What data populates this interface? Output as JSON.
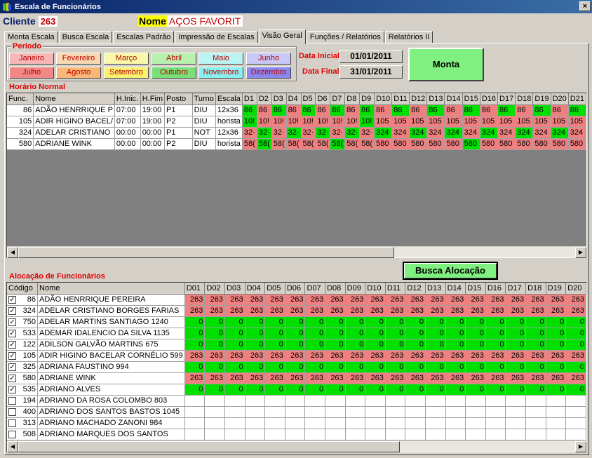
{
  "window": {
    "title": "Escala de Funcionários",
    "close_label": "×"
  },
  "header": {
    "cliente_label": "Cliente",
    "cliente_value": "263",
    "nome_label": "Nome",
    "nome_value": "AÇOS FAVORIT"
  },
  "tabs": [
    {
      "label": "Monta Escala",
      "active": false
    },
    {
      "label": "Busca Escala",
      "active": false
    },
    {
      "label": "Escalas Padrão",
      "active": false
    },
    {
      "label": "Impressão de Escalas",
      "active": false
    },
    {
      "label": "Visão Geral",
      "active": true
    },
    {
      "label": "Funções / Relatórios",
      "active": false
    },
    {
      "label": "Relatórios II",
      "active": false
    }
  ],
  "periodo": {
    "title": "Período",
    "months": [
      {
        "label": "Janeiro",
        "color": "#f4b8b8"
      },
      {
        "label": "Fevereiro",
        "color": "#f8d8b0"
      },
      {
        "label": "Março",
        "color": "#f8f8a8"
      },
      {
        "label": "Abril",
        "color": "#b8f0b0"
      },
      {
        "label": "Maio",
        "color": "#b8f4f4"
      },
      {
        "label": "Junho",
        "color": "#c8c8f8"
      },
      {
        "label": "Julho",
        "color": "#f08888"
      },
      {
        "label": "Agosto",
        "color": "#f8b878"
      },
      {
        "label": "Setembro",
        "color": "#f8f070"
      },
      {
        "label": "Outubro",
        "color": "#78e078"
      },
      {
        "label": "Novembro",
        "color": "#88f0f0"
      },
      {
        "label": "Dezembro",
        "color": "#8888f0"
      }
    ]
  },
  "datas": {
    "inicial_label": "Data Inicial",
    "inicial_value": "01/01/2011",
    "final_label": "Data Final",
    "final_value": "31/01/2011"
  },
  "monta_button": "Monta",
  "horario": {
    "title": "Horário Normal",
    "columns": [
      "Func.",
      "Nome",
      "H.Inic.",
      "H.Fim",
      "Posto",
      "Turno",
      "Escala",
      "D1",
      "D2",
      "D3",
      "D4",
      "D5",
      "D6",
      "D7",
      "D8",
      "D9",
      "D10",
      "D11",
      "D12",
      "D13",
      "D14",
      "D15",
      "D16",
      "D17",
      "D18",
      "D19",
      "D20",
      "D21"
    ],
    "rows": [
      {
        "func": "86",
        "nome": "ADÃO HENRRIQUE P",
        "hinic": "07:00",
        "hfim": "19:00",
        "posto": "P1",
        "turno": "DIU",
        "escala": "12x36",
        "days": [
          "86",
          "86",
          "86",
          "86",
          "86",
          "86",
          "86",
          "86",
          "86",
          "86",
          "86",
          "86",
          "86",
          "86",
          "86",
          "86",
          "86",
          "86",
          "86",
          "86",
          "86"
        ],
        "colors": [
          "g",
          "r",
          "g",
          "r",
          "g",
          "r",
          "g",
          "r",
          "g",
          "r",
          "g",
          "r",
          "g",
          "r",
          "g",
          "r",
          "g",
          "r",
          "g",
          "r",
          "g"
        ]
      },
      {
        "func": "105",
        "nome": "ADIR HIGINO BACEL/",
        "hinic": "07:00",
        "hfim": "19:00",
        "posto": "P2",
        "turno": "DIU",
        "escala": "horista",
        "days": [
          "10!",
          "10!",
          "10!",
          "10!",
          "10!",
          "10!",
          "10!",
          "10!",
          "10!",
          "105",
          "105",
          "105",
          "105",
          "105",
          "105",
          "105",
          "105",
          "105",
          "105",
          "105",
          "105"
        ],
        "colors": [
          "g",
          "r",
          "r",
          "r",
          "r",
          "r",
          "r",
          "r",
          "g",
          "r",
          "r",
          "r",
          "r",
          "r",
          "r",
          "r",
          "r",
          "r",
          "r",
          "r",
          "r"
        ]
      },
      {
        "func": "324",
        "nome": "ADELAR CRISTIANO",
        "hinic": "00:00",
        "hfim": "00:00",
        "posto": "P1",
        "turno": "NOT",
        "escala": "12x36",
        "days": [
          "32·",
          "32·",
          "32·",
          "32·",
          "32·",
          "32·",
          "32·",
          "32·",
          "32·",
          "324",
          "324",
          "324",
          "324",
          "324",
          "324",
          "324",
          "324",
          "324",
          "324",
          "324",
          "324"
        ],
        "colors": [
          "r",
          "g",
          "r",
          "g",
          "r",
          "g",
          "r",
          "g",
          "r",
          "g",
          "r",
          "g",
          "r",
          "g",
          "r",
          "g",
          "r",
          "g",
          "r",
          "g",
          "r"
        ]
      },
      {
        "func": "580",
        "nome": "ADRIANE WINK",
        "hinic": "00:00",
        "hfim": "00:00",
        "posto": "P2",
        "turno": "DIU",
        "escala": "horista",
        "days": [
          "58(",
          "58(",
          "58(",
          "58(",
          "58(",
          "58(",
          "58(",
          "58(",
          "58(",
          "580",
          "580",
          "580",
          "580",
          "580",
          "580",
          "580",
          "580",
          "580",
          "580",
          "580",
          "580"
        ],
        "colors": [
          "r",
          "g",
          "r",
          "r",
          "r",
          "r",
          "g",
          "r",
          "r",
          "r",
          "r",
          "r",
          "r",
          "r",
          "g",
          "r",
          "r",
          "r",
          "r",
          "r",
          "r"
        ]
      }
    ]
  },
  "busca_button": "Busca Alocação",
  "alocacao": {
    "title": "Alocação de Funcionários",
    "columns": [
      "Código",
      "Nome",
      "D01",
      "D02",
      "D03",
      "D04",
      "D05",
      "D06",
      "D07",
      "D08",
      "D09",
      "D10",
      "D11",
      "D12",
      "D13",
      "D14",
      "D15",
      "D16",
      "D17",
      "D18",
      "D19",
      "D20"
    ],
    "rows": [
      {
        "checked": true,
        "codigo": "86",
        "nome": "ADÃO HENRRIQUE PEREIRA",
        "value": "263",
        "color": "r"
      },
      {
        "checked": true,
        "codigo": "324",
        "nome": "ADELAR CRISTIANO BORGES FARIAS",
        "value": "263",
        "color": "r"
      },
      {
        "checked": true,
        "codigo": "750",
        "nome": "ADELAR MARTINS SANTIAGO 1240",
        "value": "0",
        "color": "g"
      },
      {
        "checked": true,
        "codigo": "533",
        "nome": "ADEMAR IDALENCIO DA SILVA 1135",
        "value": "0",
        "color": "g"
      },
      {
        "checked": true,
        "codigo": "122",
        "nome": "ADILSON GALVÃO MARTINS 675",
        "value": "0",
        "color": "g"
      },
      {
        "checked": true,
        "codigo": "105",
        "nome": "ADIR HIGINO BACELAR CORNÉLIO 599",
        "value": "263",
        "color": "r"
      },
      {
        "checked": true,
        "codigo": "325",
        "nome": "ADRIANA FAUSTINO 994",
        "value": "0",
        "color": "g"
      },
      {
        "checked": true,
        "codigo": "580",
        "nome": "ADRIANE WINK",
        "value": "263",
        "color": "r"
      },
      {
        "checked": true,
        "codigo": "535",
        "nome": "ADRIANO ALVES",
        "value": "0",
        "color": "g"
      },
      {
        "checked": false,
        "codigo": "194",
        "nome": "ADRIANO DA ROSA COLOMBO 803",
        "value": "",
        "color": "w"
      },
      {
        "checked": false,
        "codigo": "400",
        "nome": "ADRIANO DOS SANTOS BASTOS  1045",
        "value": "",
        "color": "w"
      },
      {
        "checked": false,
        "codigo": "313",
        "nome": "ADRIANO MACHADO ZANONI 984",
        "value": "",
        "color": "w"
      },
      {
        "checked": false,
        "codigo": "508",
        "nome": "ADRIANO MARQUES DOS SANTOS",
        "value": "",
        "color": "w"
      }
    ]
  }
}
